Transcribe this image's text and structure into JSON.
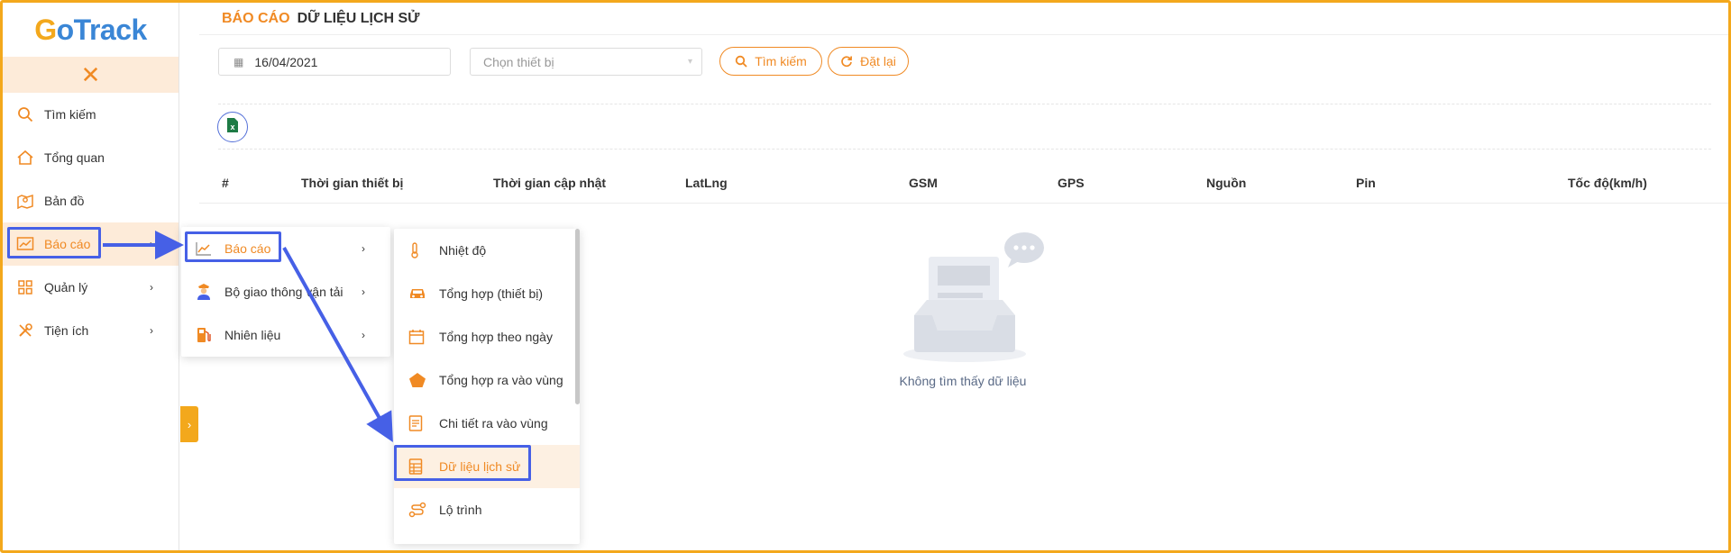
{
  "app": {
    "logo_g": "G",
    "logo_rest": "oTrack"
  },
  "colors": {
    "accent": "#f08a24",
    "highlight": "#4660e6",
    "brand_yellow": "#f3a81c",
    "brand_blue": "#3a86d6"
  },
  "sidebar": {
    "collapse_icon": "close-icon",
    "items": [
      {
        "label": "Tìm kiếm",
        "icon": "search-icon"
      },
      {
        "label": "Tổng quan",
        "icon": "home-icon"
      },
      {
        "label": "Bản đồ",
        "icon": "map-icon"
      },
      {
        "label": "Báo cáo",
        "icon": "chart-icon"
      },
      {
        "label": "Quản lý",
        "icon": "grid-icon"
      },
      {
        "label": "Tiện ích",
        "icon": "tools-icon"
      }
    ]
  },
  "header": {
    "section": "BÁO CÁO",
    "title": "DỮ LIỆU LỊCH SỬ"
  },
  "filters": {
    "date_value": "16/04/2021",
    "device_placeholder": "Chọn thiết bị",
    "search_label": "Tìm kiếm",
    "reset_label": "Đặt lại"
  },
  "table": {
    "columns": [
      "#",
      "Thời gian thiết bị",
      "Thời gian cập nhật",
      "LatLng",
      "GSM",
      "GPS",
      "Nguồn",
      "Pin",
      "Tốc độ(km/h)"
    ],
    "rows": []
  },
  "empty": {
    "text": "Không tìm thấy dữ liệu"
  },
  "submenu_level1": [
    {
      "label": "Báo cáo",
      "icon": "chart-icon"
    },
    {
      "label": "Bộ giao thông vận tải",
      "icon": "officer-icon"
    },
    {
      "label": "Nhiên liệu",
      "icon": "fuel-icon"
    }
  ],
  "submenu_level2": [
    {
      "label": "Nhiệt độ",
      "icon": "thermometer-icon"
    },
    {
      "label": "Tổng hợp (thiết bị)",
      "icon": "car-icon"
    },
    {
      "label": "Tổng hợp theo ngày",
      "icon": "calendar-icon"
    },
    {
      "label": "Tổng hợp ra vào vùng",
      "icon": "pentagon-icon"
    },
    {
      "label": "Chi tiết ra vào vùng",
      "icon": "document-icon"
    },
    {
      "label": "Dữ liệu lịch sử",
      "icon": "table-icon"
    },
    {
      "label": "Lộ trình",
      "icon": "route-icon"
    }
  ]
}
